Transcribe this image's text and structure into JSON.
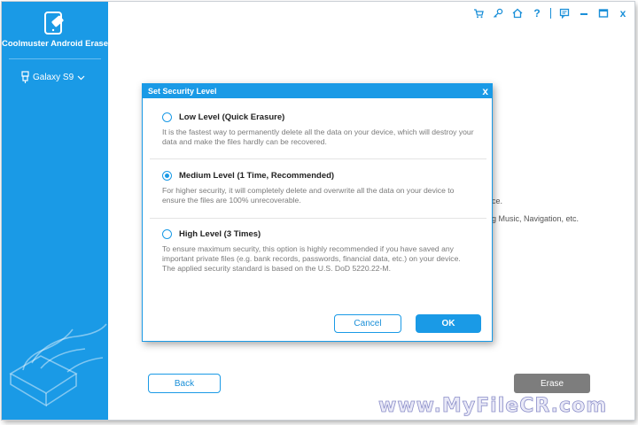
{
  "app": {
    "name": "Coolmuster Android Eraser"
  },
  "sidebar": {
    "device_label": "Galaxy S9"
  },
  "titlebar": {
    "icons": [
      "cart-icon",
      "key-icon",
      "home-icon",
      "help-icon",
      "feedback-icon",
      "minimize-icon",
      "maximize-icon",
      "close-icon"
    ],
    "help_glyph": "?",
    "close_glyph": "x"
  },
  "background": {
    "text_1": "ce.",
    "text_2": "g Music, Navigation, etc."
  },
  "buttons": {
    "back": "Back",
    "erase": "Erase"
  },
  "dialog": {
    "title": "Set Security Level",
    "close": "x",
    "options": [
      {
        "label": "Low Level (Quick Erasure)",
        "description": "It is the fastest way to permanently delete all the data on your device, which will destroy your data and make the files hardly can be recovered.",
        "selected": false
      },
      {
        "label": "Medium Level (1 Time, Recommended)",
        "description": "For higher security, it will completely delete and overwrite all the data on your device to ensure the files are 100% unrecoverable.",
        "selected": true
      },
      {
        "label": "High Level (3 Times)",
        "description": "To ensure maximum security, this option is highly recommended if you have saved any important private files (e.g. bank records, passwords, financial data, etc.) on your device. The applied security standard is based on the U.S. DoD 5220.22-M.",
        "selected": false
      }
    ],
    "cancel": "Cancel",
    "ok": "OK"
  },
  "watermark": "www.MyFileCR.com",
  "colors": {
    "accent": "#1a9ae6",
    "erase_disabled": "#7d7d7d"
  }
}
